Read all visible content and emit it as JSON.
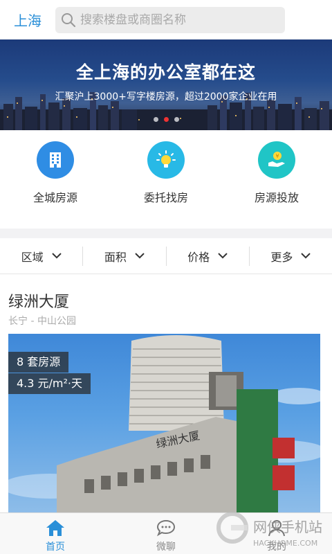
{
  "header": {
    "city": "上海",
    "search_placeholder": "搜索楼盘或商圈名称"
  },
  "banner": {
    "title": "全上海的办公室都在这",
    "subtitle": "汇聚沪上3000+写字楼房源，超过2000家企业在用",
    "slide_count": 3,
    "active_slide": 2
  },
  "quick_entries": [
    {
      "label": "全城房源",
      "icon": "building-icon",
      "color": "#2f8de4"
    },
    {
      "label": "委托找房",
      "icon": "lightbulb-icon",
      "color": "#28b9e6"
    },
    {
      "label": "房源投放",
      "icon": "hand-coin-icon",
      "color": "#20c5c6"
    }
  ],
  "filters": [
    {
      "label": "区域"
    },
    {
      "label": "面积"
    },
    {
      "label": "价格"
    },
    {
      "label": "更多"
    }
  ],
  "listing": {
    "name": "绿洲大厦",
    "location": "长宁 - 中山公园",
    "units": "8 套房源",
    "price": "4.3 元/m²·天"
  },
  "bottom_nav": [
    {
      "label": "首页",
      "icon": "home-icon",
      "active": true
    },
    {
      "label": "微聊",
      "icon": "chat-icon",
      "active": false
    },
    {
      "label": "我的",
      "icon": "user-icon",
      "active": false
    }
  ],
  "watermark": {
    "text": "网侠手机站",
    "url_text": "HACKHOME.COM"
  },
  "colors": {
    "accent": "#2a8fd8",
    "active_dot": "#e33333"
  }
}
